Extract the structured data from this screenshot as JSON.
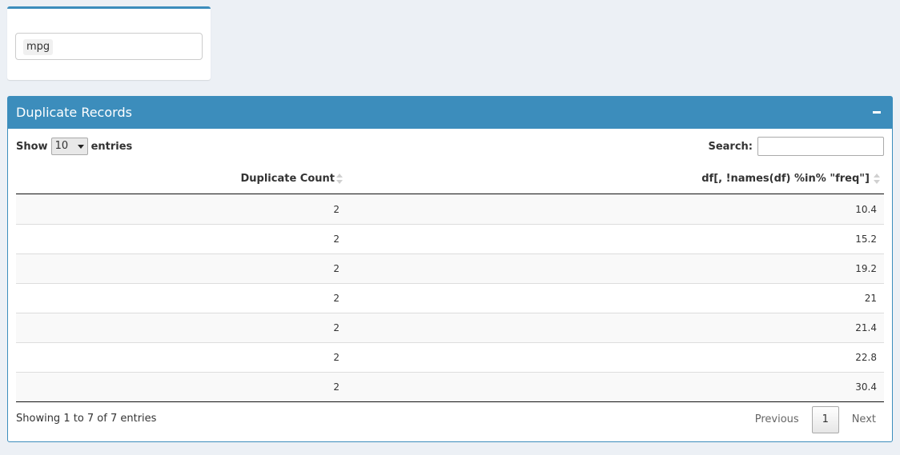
{
  "selector": {
    "selected": "mpg"
  },
  "panel": {
    "title": "Duplicate Records",
    "length": {
      "prefix": "Show",
      "value": "10",
      "suffix": "entries"
    },
    "search": {
      "label": "Search:",
      "value": ""
    },
    "table": {
      "columns": [
        "Duplicate Count",
        "df[, !names(df) %in% \"freq\"]"
      ],
      "rows": [
        [
          "2",
          "10.4"
        ],
        [
          "2",
          "15.2"
        ],
        [
          "2",
          "19.2"
        ],
        [
          "2",
          "21"
        ],
        [
          "2",
          "21.4"
        ],
        [
          "2",
          "22.8"
        ],
        [
          "2",
          "30.4"
        ]
      ]
    },
    "info": "Showing 1 to 7 of 7 entries",
    "pagination": {
      "previous": "Previous",
      "current": "1",
      "next": "Next"
    }
  },
  "colors": {
    "accent": "#3c8dbc",
    "background": "#ecf0f5"
  }
}
